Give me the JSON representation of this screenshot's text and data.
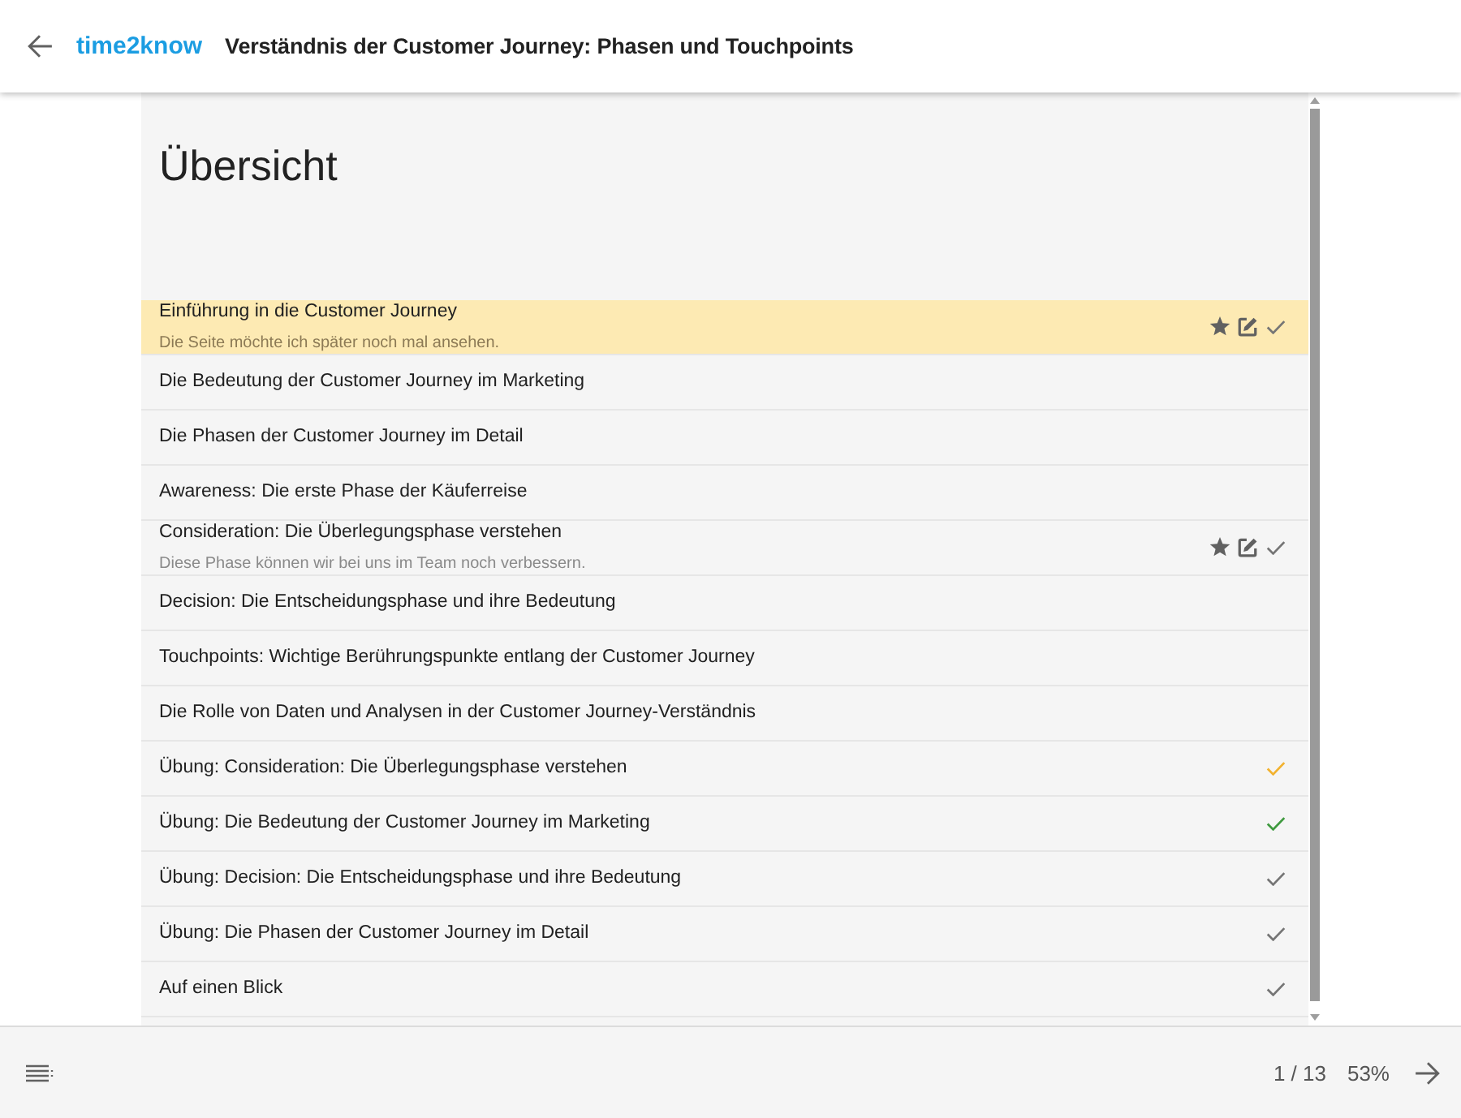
{
  "header": {
    "logo": "time2know",
    "title": "Verständnis der Customer Journey: Phasen und Touchpoints"
  },
  "overview": {
    "heading": "Übersicht",
    "items": [
      {
        "title": "Einführung in die Customer Journey",
        "note": "Die Seite möchte ich später noch mal ansehen.",
        "selected": true,
        "bookmarked": true,
        "checked": true,
        "color": "#757575"
      },
      {
        "title": "Die Bedeutung der Customer Journey im Marketing",
        "selected": false,
        "bookmarked": false,
        "checked": false
      },
      {
        "title": "Die Phasen der Customer Journey im Detail",
        "selected": false,
        "bookmarked": false,
        "checked": false
      },
      {
        "title": "Awareness: Die erste Phase der Käuferreise",
        "selected": false,
        "bookmarked": false,
        "checked": false
      },
      {
        "title": "Consideration: Die Überlegungsphase verstehen",
        "note": "Diese Phase können wir bei uns im Team noch verbessern.",
        "selected": false,
        "bookmarked": true,
        "checked": true,
        "color": "#757575"
      },
      {
        "title": "Decision: Die Entscheidungsphase und ihre Bedeutung",
        "selected": false,
        "bookmarked": false,
        "checked": false
      },
      {
        "title": "Touchpoints: Wichtige Berührungspunkte entlang der Customer Journey",
        "selected": false,
        "bookmarked": false,
        "checked": false
      },
      {
        "title": "Die Rolle von Daten und Analysen in der Customer Journey-Verständnis",
        "selected": false,
        "bookmarked": false,
        "checked": false
      },
      {
        "title": "Übung: Consideration: Die Überlegungsphase verstehen",
        "selected": false,
        "bookmarked": false,
        "checked": true,
        "color": "#f2b230"
      },
      {
        "title": "Übung: Die Bedeutung der Customer Journey im Marketing",
        "selected": false,
        "bookmarked": false,
        "checked": true,
        "color": "#3f9a3f"
      },
      {
        "title": "Übung: Decision: Die Entscheidungsphase und ihre Bedeutung",
        "selected": false,
        "bookmarked": false,
        "checked": true,
        "color": "#757575"
      },
      {
        "title": "Übung: Die Phasen der Customer Journey im Detail",
        "selected": false,
        "bookmarked": false,
        "checked": true,
        "color": "#757575"
      },
      {
        "title": "Auf einen Blick",
        "selected": false,
        "bookmarked": false,
        "checked": true,
        "color": "#757575"
      }
    ]
  },
  "footer": {
    "page": "1 / 13",
    "progress": "53%"
  }
}
